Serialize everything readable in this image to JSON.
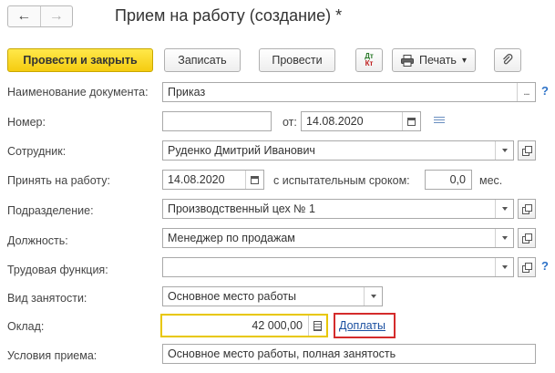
{
  "window": {
    "title": "Прием на работу (создание) *"
  },
  "nav": {
    "back_glyph": "←",
    "forward_glyph": "→"
  },
  "toolbar": {
    "post_close_label": "Провести и закрыть",
    "save_label": "Записать",
    "post_label": "Провести",
    "dtkt_top": "Дт",
    "dtkt_bottom": "Кт",
    "print_label": "Печать",
    "print_arrow": "▾",
    "attach_icon": "paperclip-icon"
  },
  "form": {
    "doc_name": {
      "label": "Наименование документа:",
      "value": "Приказ",
      "button": "..."
    },
    "number": {
      "label": "Номер:",
      "value": "",
      "date_label": "от:",
      "date_value": "14.08.2020"
    },
    "employee": {
      "label": "Сотрудник:",
      "value": "Руденко Дмитрий Иванович"
    },
    "hire": {
      "label": "Принять на работу:",
      "date_value": "14.08.2020",
      "probation_label": "с испытательным сроком:",
      "probation_value": "0,0",
      "unit": "мес."
    },
    "department": {
      "label": "Подразделение:",
      "value": "Производственный цех № 1"
    },
    "position": {
      "label": "Должность:",
      "value": "Менеджер по продажам"
    },
    "labor_function": {
      "label": "Трудовая функция:",
      "value": ""
    },
    "employment_type": {
      "label": "Вид занятости:",
      "value": "Основное место работы"
    },
    "salary": {
      "label": "Оклад:",
      "value": "42 000,00",
      "link": "Доплаты"
    },
    "conditions": {
      "label": "Условия приема:",
      "value": "Основное место работы, полная занятость"
    },
    "help_glyph": "?"
  },
  "colors": {
    "primary_button": "#f5cc10",
    "highlight_border": "#d42b2b",
    "help": "#2e73c8",
    "link": "#1a4fa0",
    "salary_focus": "#e8c700"
  }
}
